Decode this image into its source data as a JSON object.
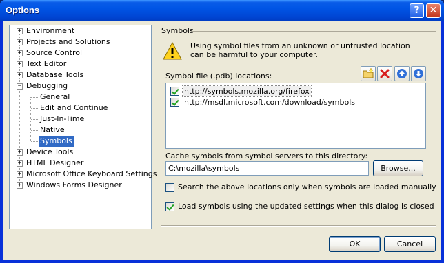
{
  "window": {
    "title": "Options",
    "help_button": "?",
    "close_button": "✕"
  },
  "tree": {
    "items": [
      {
        "label": "Environment",
        "expander": "+"
      },
      {
        "label": "Projects and Solutions",
        "expander": "+"
      },
      {
        "label": "Source Control",
        "expander": "+"
      },
      {
        "label": "Text Editor",
        "expander": "+"
      },
      {
        "label": "Database Tools",
        "expander": "+"
      },
      {
        "label": "Debugging",
        "expander": "−"
      },
      {
        "label": "General"
      },
      {
        "label": "Edit and Continue"
      },
      {
        "label": "Just-In-Time"
      },
      {
        "label": "Native"
      },
      {
        "label": "Symbols",
        "selected": true
      },
      {
        "label": "Device Tools",
        "expander": "+"
      },
      {
        "label": "HTML Designer",
        "expander": "+"
      },
      {
        "label": "Microsoft Office Keyboard Settings",
        "expander": "+"
      },
      {
        "label": "Windows Forms Designer",
        "expander": "+"
      }
    ]
  },
  "symbols": {
    "section_title": "Symbols",
    "warning": "Using symbol files from an unknown or untrusted location can be harmful to your computer.",
    "locations_label": "Symbol file (.pdb) locations:",
    "toolbar_icons": [
      "new-folder-icon",
      "delete-icon",
      "move-up-icon",
      "move-down-icon"
    ],
    "locations": [
      {
        "url": "http://symbols.mozilla.org/firefox",
        "checked": true
      },
      {
        "url": "http://msdl.microsoft.com/download/symbols",
        "checked": true
      }
    ],
    "cache_label": "Cache symbols from symbol servers to this directory:",
    "cache_value": "C:\\mozilla\\symbols",
    "browse_label": "Browse...",
    "manual_only_label": "Search the above locations only when symbols are loaded manually",
    "manual_only_checked": false,
    "load_now_label": "Load symbols using the updated settings when this dialog is closed",
    "load_now_checked": true
  },
  "footer": {
    "ok_label": "OK",
    "cancel_label": "Cancel"
  },
  "colors": {
    "title_bar": "#0055e5",
    "selection": "#316ac5",
    "dialog_bg": "#ece9d8",
    "warning_yellow": "#ffd21e"
  }
}
